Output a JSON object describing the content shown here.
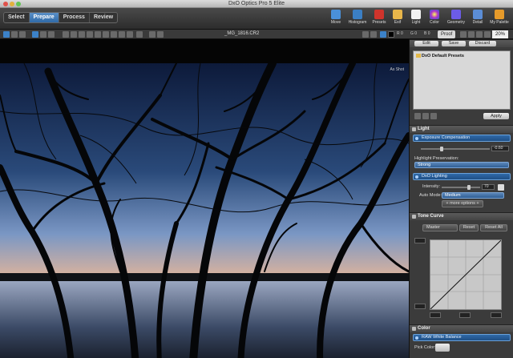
{
  "window": {
    "title": "DxO Optics Pro 5 Elite"
  },
  "modes": [
    {
      "label": "Select",
      "active": false
    },
    {
      "label": "Prepare",
      "active": true
    },
    {
      "label": "Process",
      "active": false
    },
    {
      "label": "Review",
      "active": false
    }
  ],
  "palettes": [
    {
      "label": "Move",
      "icon": "move-icon",
      "color": "#4a90d9"
    },
    {
      "label": "Histogram",
      "icon": "histogram-icon",
      "color": "#3b7fc4"
    },
    {
      "label": "Presets",
      "icon": "presets-icon",
      "color": "#d0342c"
    },
    {
      "label": "Exif",
      "icon": "exif-icon",
      "color": "#e8b64a"
    },
    {
      "label": "Light",
      "icon": "light-icon",
      "color": "#f0f0f0"
    },
    {
      "label": "Color",
      "icon": "color-icon",
      "color": "#9b59b6"
    },
    {
      "label": "Geometry",
      "icon": "geometry-icon",
      "color": "#6c5ce7"
    },
    {
      "label": "Detail",
      "icon": "detail-icon",
      "color": "#5b8dd6"
    },
    {
      "label": "My Palette",
      "icon": "my-palette-icon",
      "color": "#e69a2a"
    }
  ],
  "viewer": {
    "filename": "_MG_1816.CR2",
    "rgb": [
      "R 0",
      "G 0",
      "B 0"
    ],
    "proof_label": "Proof",
    "zoom": "20%",
    "overlay_label": "As Shot"
  },
  "presets_panel": {
    "edit_label": "Edit",
    "save_label": "Save",
    "discard_label": "Discard",
    "folder_label": "DxO Default Presets",
    "apply_label": "Apply"
  },
  "light_panel": {
    "title": "Light",
    "exposure": {
      "title": "Exposure Compensation",
      "value": "-0.60",
      "highlight_label": "Highlight Preservation:",
      "highlight_value": "Strong"
    },
    "lighting": {
      "title": "DxO Lighting",
      "intensity_label": "Intensity:",
      "intensity_value": "70",
      "auto_mode_label": "Auto Mode:",
      "auto_mode_value": "Medium",
      "more_options_label": "+ more options +"
    },
    "tone_curve": {
      "title": "Tone Curve",
      "channel": "Master",
      "reset_label": "Reset",
      "reset_all_label": "Reset All"
    }
  },
  "color_panel": {
    "title": "Color",
    "white_balance_title": "RAW White Balance",
    "pick_color_label": "Pick Color:"
  }
}
